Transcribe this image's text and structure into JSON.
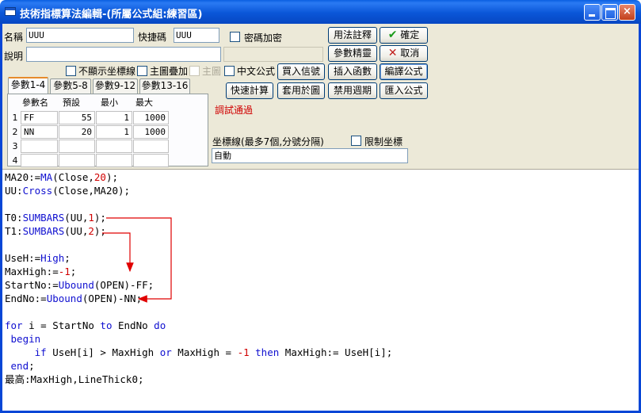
{
  "window": {
    "title": "技術指標算法編輯-(所屬公式組:練習區)",
    "controls": {
      "minimize": "_",
      "maximize": "□",
      "close": "×"
    }
  },
  "form": {
    "name_label": "名稱",
    "name_value": "UUU",
    "shortcut_label": "快捷碼",
    "shortcut_value": "UUU",
    "password_label": "密碼加密",
    "desc_label": "說明",
    "desc_value": "",
    "hide_axis_label": "不顯示坐標線",
    "main_overlay_label": "主圖疊加",
    "main_chart_label": "主圖",
    "chinese_formula_label": "中文公式",
    "status_text": "調試通過",
    "axis_line_label": "坐標線(最多7個,分號分隔)",
    "limit_axis_label": "限制坐標",
    "axis_line_value": "自動"
  },
  "buttons": {
    "usage_note": "用法註釋",
    "ok": "確定",
    "param_wizard": "參數精靈",
    "cancel": "取消",
    "buy_signal": "買入信號",
    "insert_function": "插入函數",
    "compile_formula": "編譯公式",
    "quick_calc": "快速計算",
    "apply_to_chart": "套用於圖",
    "disable_period": "禁用週期",
    "import_formula": "匯入公式"
  },
  "tabs": [
    {
      "label": "參數1-4"
    },
    {
      "label": "參數5-8"
    },
    {
      "label": "參數9-12"
    },
    {
      "label": "參數13-16"
    }
  ],
  "params": {
    "headers": [
      "參數名",
      "預設",
      "最小",
      "最大"
    ],
    "rows": [
      {
        "num": "1",
        "name": "FF",
        "default": "55",
        "min": "1",
        "max": "1000"
      },
      {
        "num": "2",
        "name": "NN",
        "default": "20",
        "min": "1",
        "max": "1000"
      },
      {
        "num": "3",
        "name": "",
        "default": "",
        "min": "",
        "max": ""
      },
      {
        "num": "4",
        "name": "",
        "default": "",
        "min": "",
        "max": ""
      }
    ]
  },
  "code_lines": [
    "MA20:=MA(Close,20);",
    "UU:Cross(Close,MA20);",
    "",
    "T0:SUMBARS(UU,1);",
    "T1:SUMBARS(UU,2);",
    "",
    "UseH:=High;",
    "MaxHigh:=-1;",
    "StartNo:=Ubound(OPEN)-FF;",
    "EndNo:=Ubound(OPEN)-NN;",
    "",
    "for i = StartNo to EndNo do",
    " begin",
    "     if UseH[i] > MaxHigh or MaxHigh = -1 then MaxHigh:= UseH[i];",
    " end;",
    "最高:MaxHigh,LineThick0;"
  ],
  "colors": {
    "keyword": "#1010d0",
    "number": "#d00000",
    "status": "#d00000",
    "arrow": "#e00000"
  }
}
